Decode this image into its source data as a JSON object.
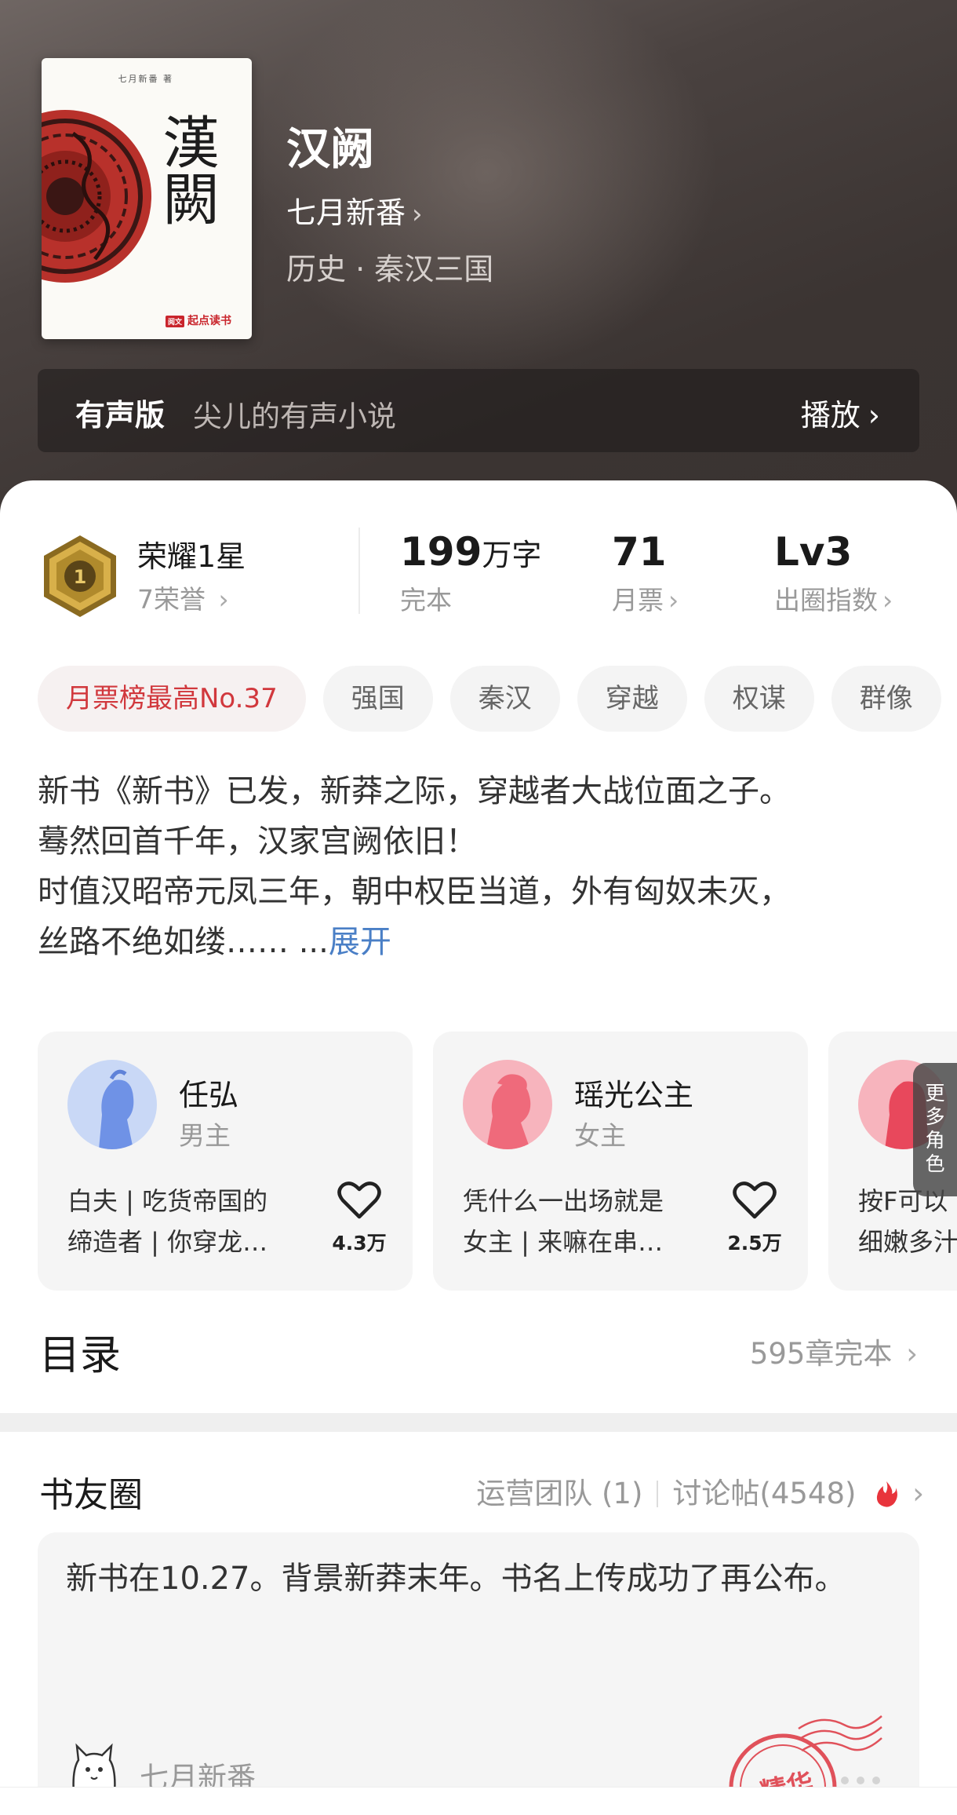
{
  "book": {
    "title": "汉阙",
    "author": "七月新番",
    "genre": "历史 · 秦汉三国",
    "cover_title": "漢闕",
    "cover_top_text": "七月新番 著",
    "cover_brand": "起点读书",
    "cover_brand_mark": "阅文"
  },
  "audio": {
    "label": "有声版",
    "description": "尖儿的有声小说",
    "play_label": "播放"
  },
  "honor": {
    "badge_number": "1",
    "name": "荣耀1星",
    "sub": "7荣誉"
  },
  "stats": {
    "words_value": "199",
    "words_unit": "万字",
    "words_label": "完本",
    "tickets_value": "71",
    "tickets_label": "月票",
    "level_value": "Lv3",
    "level_label": "出圈指数"
  },
  "tags": [
    "月票榜最高No.37",
    "强国",
    "秦汉",
    "穿越",
    "权谋",
    "群像"
  ],
  "description": {
    "lines": [
      "新书《新书》已发，新莽之际，穿越者大战位面之子。",
      "蓦然回首千年，汉家宫阙依旧！",
      "时值汉昭帝元凤三年，朝中权臣当道，外有匈奴未灭，",
      "丝路不绝如缕…… ..."
    ],
    "expand_label": "展开"
  },
  "roles": [
    {
      "name": "任弘",
      "type": "男主",
      "desc_line1": "白夫 | 吃货帝国的",
      "desc_line2": "缔造者 | 你穿龙…",
      "likes": "4.3万"
    },
    {
      "name": "瑶光公主",
      "type": "女主",
      "desc_line1": "凭什么一出场就是",
      "desc_line2": "女主 | 来嘛在串…",
      "likes": "2.5万"
    },
    {
      "name": "",
      "type": "",
      "desc_line1": "按F可以",
      "desc_line2": "细嫩多汁",
      "likes": ""
    }
  ],
  "more_roles_label": "更多角色",
  "toc": {
    "title": "目录",
    "meta": "595章完本"
  },
  "circle": {
    "title": "书友圈",
    "team_label": "运营团队 (1)",
    "posts_label": "讨论帖(4548)",
    "post_text": "新书在10.27。背景新莽末年。书名上传成功了再公布。",
    "post_author": "七月新番",
    "stamp_text": "精华"
  },
  "colors": {
    "accent_red": "#d1383d",
    "link_blue": "#4a7fc6",
    "hero_dark": "#3b3432"
  }
}
